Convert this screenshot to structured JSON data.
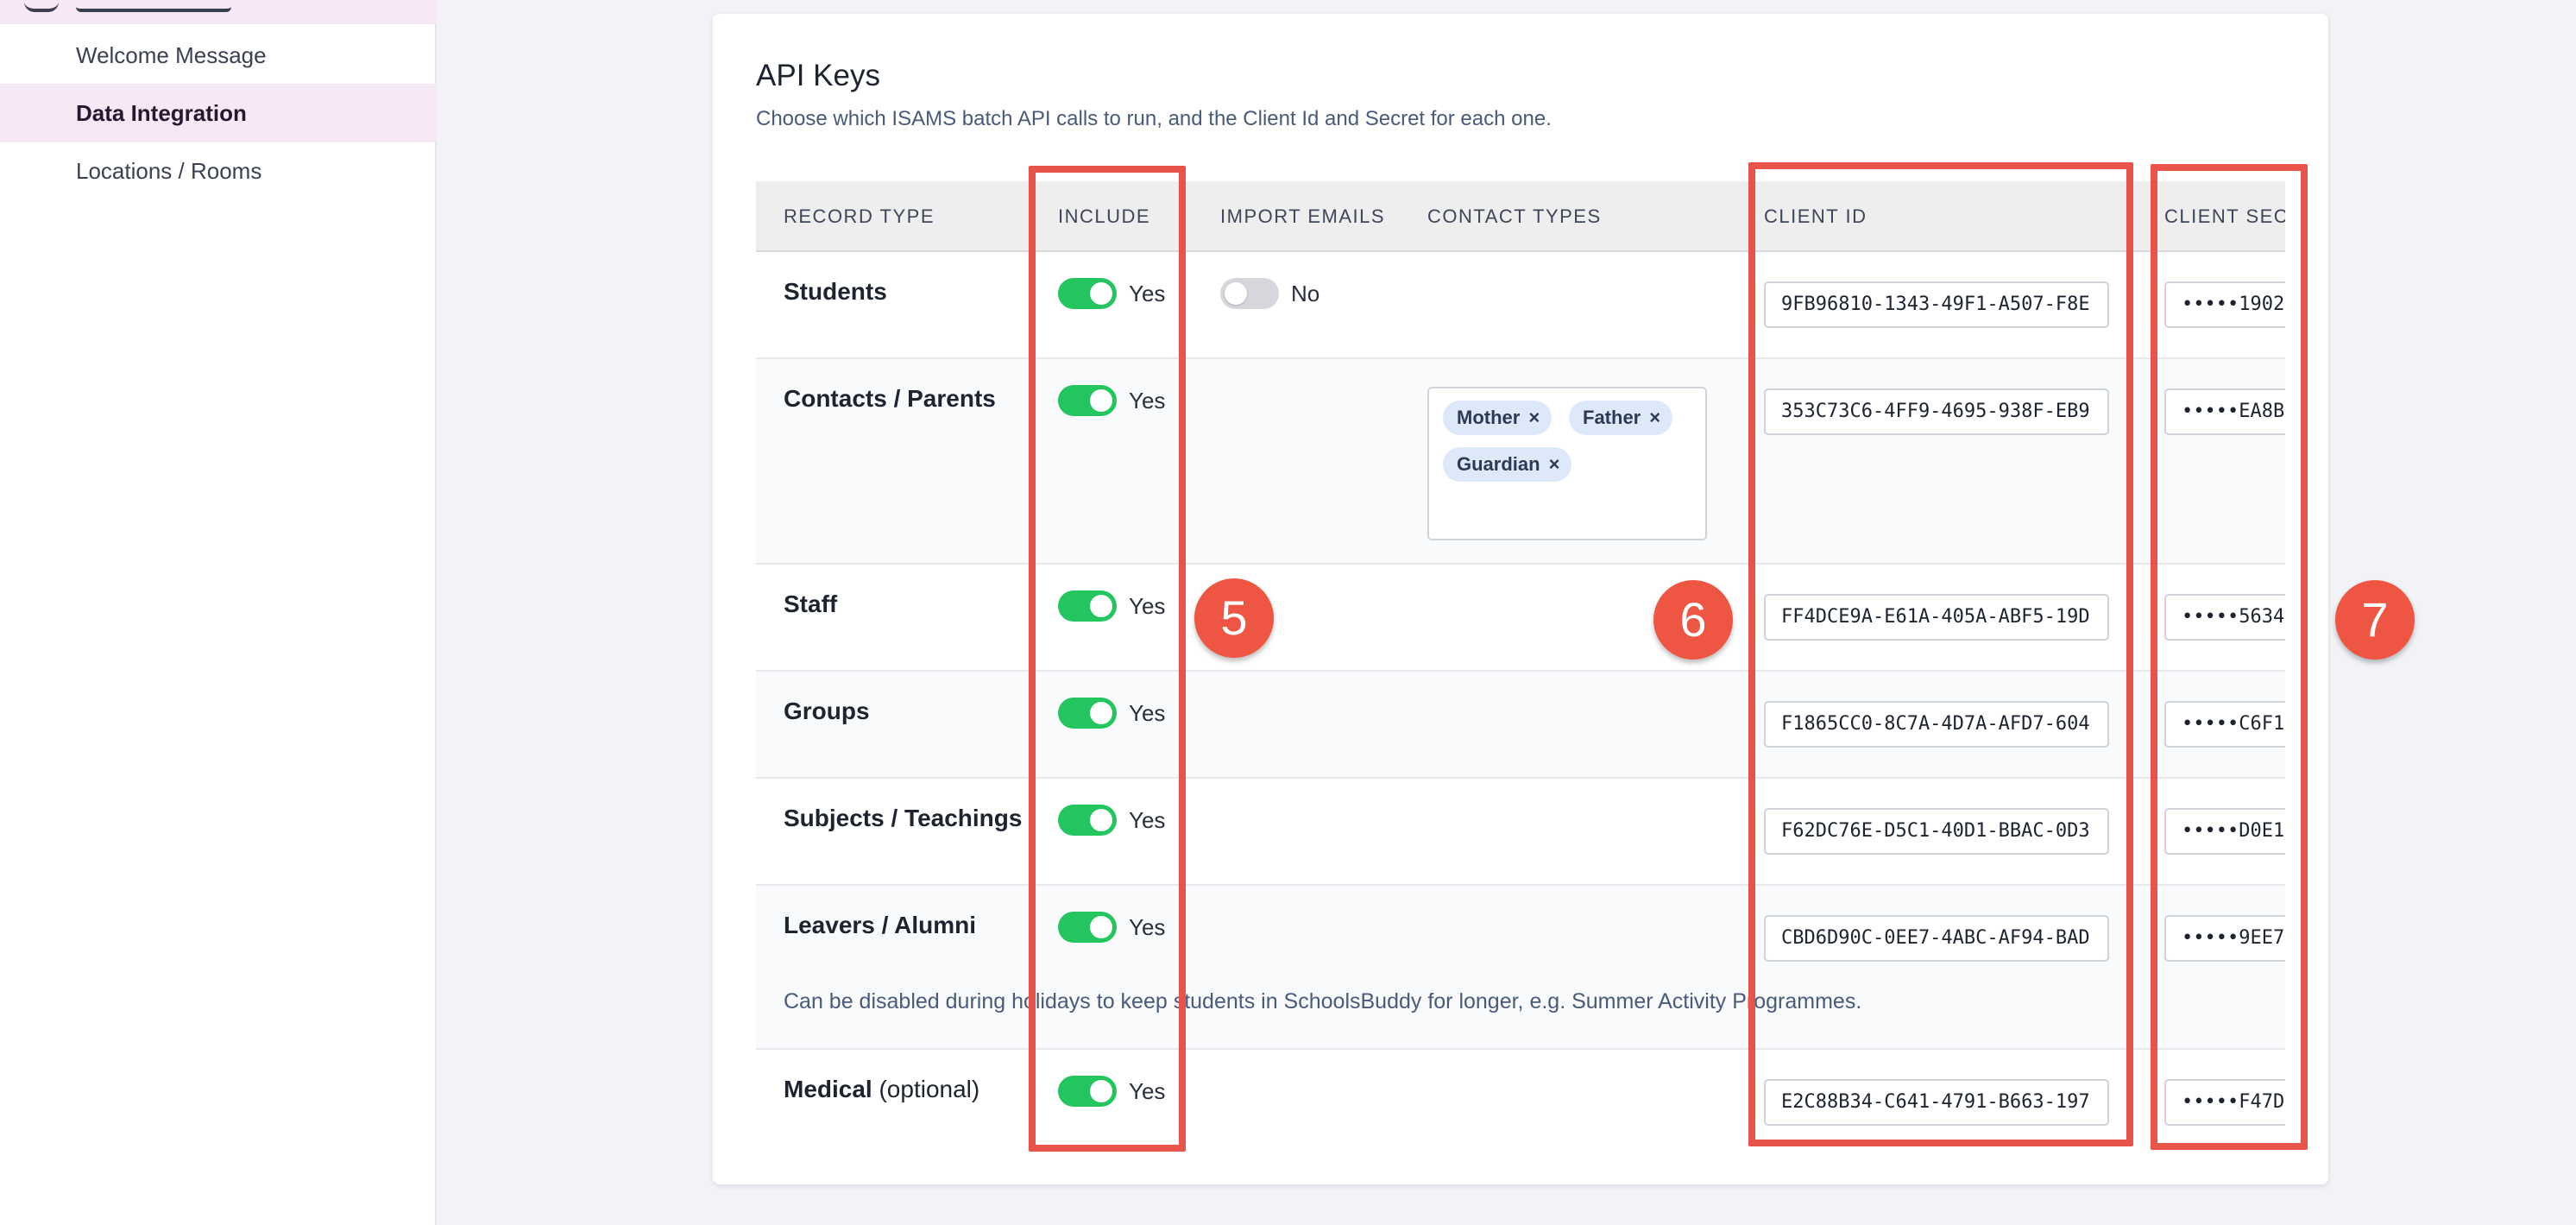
{
  "sidebar": {
    "items": [
      {
        "label": "Welcome Message",
        "active": false
      },
      {
        "label": "Data Integration",
        "active": true
      },
      {
        "label": "Locations / Rooms",
        "active": false
      }
    ]
  },
  "card": {
    "title": "API Keys",
    "subtitle": "Choose which ISAMS batch API calls to run, and the Client Id and Secret for each one."
  },
  "table": {
    "headers": {
      "record_type": "RECORD TYPE",
      "include": "INCLUDE",
      "import_emails": "IMPORT EMAILS",
      "contact_types": "CONTACT TYPES",
      "client_id": "CLIENT ID",
      "client_secret": "CLIENT SECR"
    },
    "rows": [
      {
        "label": "Students",
        "include": "Yes",
        "import_emails": "No",
        "client_id": "9FB96810-1343-49F1-A507-F8E",
        "client_secret": "•••••1902"
      },
      {
        "label": "Contacts / Parents",
        "include": "Yes",
        "client_id": "353C73C6-4FF9-4695-938F-EB9",
        "client_secret": "•••••EA8B",
        "contact_types": [
          "Mother",
          "Father",
          "Guardian"
        ]
      },
      {
        "label": "Staff",
        "include": "Yes",
        "client_id": "FF4DCE9A-E61A-405A-ABF5-19D",
        "client_secret": "•••••5634"
      },
      {
        "label": "Groups",
        "include": "Yes",
        "client_id": "F1865CC0-8C7A-4D7A-AFD7-604",
        "client_secret": "•••••C6F1"
      },
      {
        "label": "Subjects / Teachings",
        "include": "Yes",
        "client_id": "F62DC76E-D5C1-40D1-BBAC-0D3",
        "client_secret": "•••••D0E1"
      },
      {
        "label": "Leavers / Alumni",
        "include": "Yes",
        "client_id": "CBD6D90C-0EE7-4ABC-AF94-BAD",
        "client_secret": "•••••9EE7",
        "note": "Can be disabled during holidays to keep students in SchoolsBuddy for longer, e.g. Summer Activity Programmes."
      },
      {
        "label": "Medical",
        "label_suffix": "(optional)",
        "include": "Yes",
        "client_id": "E2C88B34-C641-4791-B663-197",
        "client_secret": "•••••F47D"
      }
    ],
    "tag_remove_glyph": "×"
  },
  "annotations": {
    "badges": [
      "5",
      "6",
      "7"
    ],
    "color": "#e8544a"
  },
  "colors": {
    "toggle_on": "#22c55e",
    "toggle_off": "#d5d7dc",
    "sidebar_active": "#f6e9f5",
    "tag_bg": "#dde8f8"
  }
}
